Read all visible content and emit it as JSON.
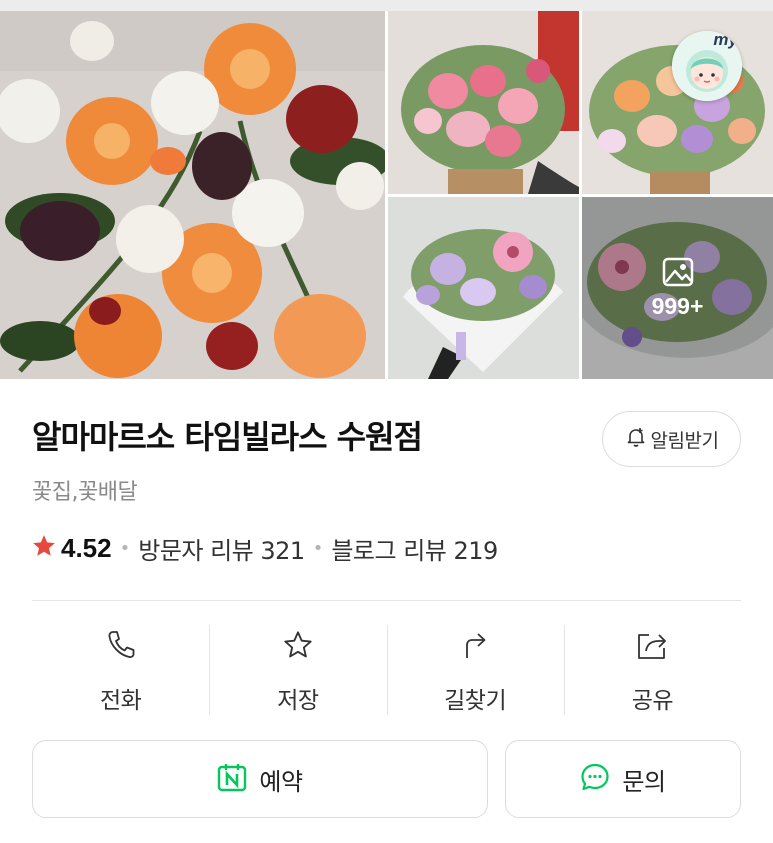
{
  "gallery": {
    "more_count": "999+",
    "my_badge_label": "my"
  },
  "place": {
    "name": "알마마르소 타임빌라스 수원점",
    "category": "꽃집,꽃배달",
    "rating": "4.52",
    "visitor_reviews": "방문자 리뷰 321",
    "blog_reviews": "블로그 리뷰 219",
    "notify_label": "알림받기"
  },
  "actions": [
    {
      "label": "전화",
      "icon": "phone-icon"
    },
    {
      "label": "저장",
      "icon": "star-icon"
    },
    {
      "label": "길찾기",
      "icon": "directions-icon"
    },
    {
      "label": "공유",
      "icon": "share-icon"
    }
  ],
  "buttons": {
    "reserve_label": "예약",
    "inquiry_label": "문의"
  },
  "colors": {
    "star": "#e8473b",
    "naver_green": "#03c75a"
  }
}
